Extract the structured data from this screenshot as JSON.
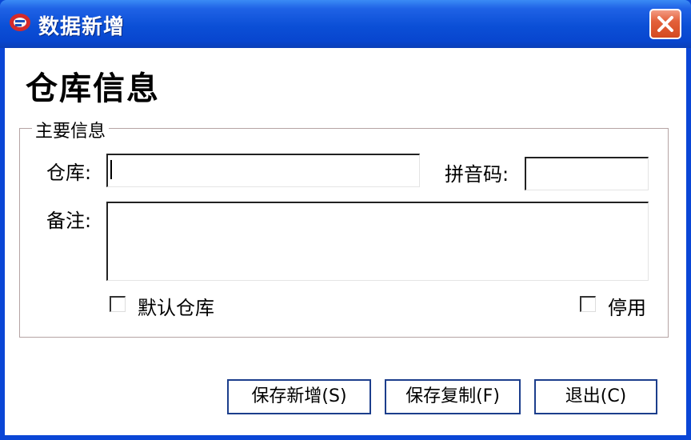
{
  "window": {
    "title": "数据新增",
    "icon": "app-logo-icon",
    "close_icon": "close-icon",
    "colors": {
      "titlebar": "#0b4fd6",
      "close": "#d44a20"
    }
  },
  "form": {
    "heading": "仓库信息",
    "group_title": "主要信息",
    "warehouse_label": "仓库:",
    "warehouse_value": "",
    "pinyin_label": "拼音码:",
    "pinyin_value": "",
    "note_label": "备注:",
    "note_value": "",
    "default_checkbox_label": "默认仓库",
    "default_checked": false,
    "disable_checkbox_label": "停用",
    "disable_checked": false
  },
  "buttons": {
    "save_new": "保存新增(S)",
    "save_copy": "保存复制(F)",
    "exit": "退出(C)"
  }
}
